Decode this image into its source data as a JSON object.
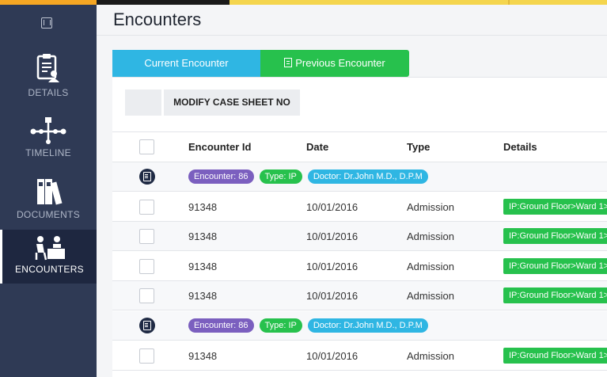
{
  "sidebar": {
    "items": [
      {
        "label": "DETAILS",
        "icon": "clipboard-user-icon"
      },
      {
        "label": "TIMELINE",
        "icon": "timeline-icon"
      },
      {
        "label": "DOCUMENTS",
        "icon": "binders-icon"
      },
      {
        "label": "ENCOUNTERS",
        "icon": "consultation-icon",
        "active": true
      }
    ]
  },
  "page": {
    "title": "Encounters"
  },
  "tabs": [
    {
      "label": "Current Encounter",
      "color": "#2fb6e3"
    },
    {
      "label": "Previous Encounter",
      "color": "#27c14d"
    }
  ],
  "toolbar": {
    "modify_label": "MODIFY CASE SHEET NO"
  },
  "table": {
    "headers": [
      "Encounter Id",
      "Date",
      "Type",
      "Details"
    ],
    "groups": [
      {
        "badges": [
          "Encounter: 86",
          "Type: IP",
          "Doctor: Dr.John M.D., D.P.M"
        ],
        "rows": [
          {
            "id": "91348",
            "date": "10/01/2016",
            "type": "Admission",
            "details": "IP:Ground Floor>Ward 1>"
          },
          {
            "id": "91348",
            "date": "10/01/2016",
            "type": "Admission",
            "details": "IP:Ground Floor>Ward 1>"
          },
          {
            "id": "91348",
            "date": "10/01/2016",
            "type": "Admission",
            "details": "IP:Ground Floor>Ward 1>"
          },
          {
            "id": "91348",
            "date": "10/01/2016",
            "type": "Admission",
            "details": "IP:Ground Floor>Ward 1>"
          }
        ]
      },
      {
        "badges": [
          "Encounter: 86",
          "Type: IP",
          "Doctor: Dr.John M.D., D.P.M"
        ],
        "rows": [
          {
            "id": "91348",
            "date": "10/01/2016",
            "type": "Admission",
            "details": "IP:Ground Floor>Ward 1>"
          }
        ]
      }
    ]
  },
  "colors": {
    "sidebar_bg": "#2f3a55",
    "accent_yellow": "#f4d54e",
    "green": "#27c14d",
    "cyan": "#2fb6e3",
    "purple": "#7b5fbf"
  }
}
